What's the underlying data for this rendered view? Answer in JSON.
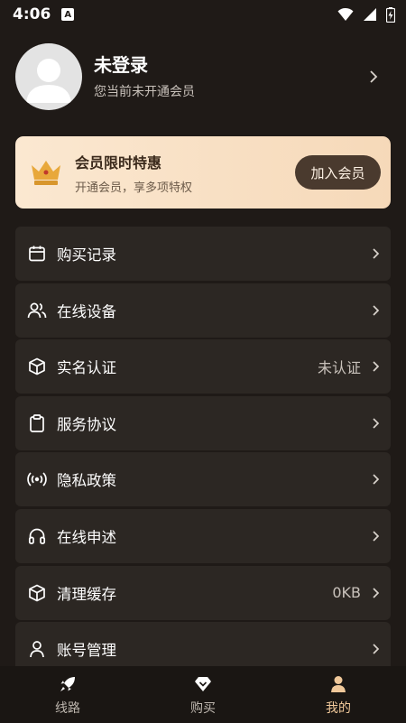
{
  "status_bar": {
    "time": "4:06",
    "notification": "A"
  },
  "profile": {
    "name": "未登录",
    "subtitle": "您当前未开通会员"
  },
  "vip": {
    "title": "会员限时特惠",
    "subtitle": "开通会员，享多项特权",
    "button": "加入会员"
  },
  "menu": [
    {
      "icon": "calendar-icon",
      "label": "购买记录",
      "value": ""
    },
    {
      "icon": "users-icon",
      "label": "在线设备",
      "value": ""
    },
    {
      "icon": "cube-icon",
      "label": "实名认证",
      "value": "未认证"
    },
    {
      "icon": "clipboard-icon",
      "label": "服务协议",
      "value": ""
    },
    {
      "icon": "broadcast-icon",
      "label": "隐私政策",
      "value": ""
    },
    {
      "icon": "headphones-icon",
      "label": "在线申述",
      "value": ""
    },
    {
      "icon": "box-icon",
      "label": "清理缓存",
      "value": "0KB"
    },
    {
      "icon": "user-icon",
      "label": "账号管理",
      "value": ""
    }
  ],
  "bottom_nav": [
    {
      "icon": "rocket-icon",
      "label": "线路",
      "active": false
    },
    {
      "icon": "diamond-icon",
      "label": "购买",
      "active": false
    },
    {
      "icon": "person-icon",
      "label": "我的",
      "active": true
    }
  ],
  "colors": {
    "background": "#1f1a17",
    "card": "#2c2723",
    "accent": "#f0c89a",
    "vip_gradient_start": "#fbe8d1",
    "vip_button": "#4a3a2e"
  }
}
